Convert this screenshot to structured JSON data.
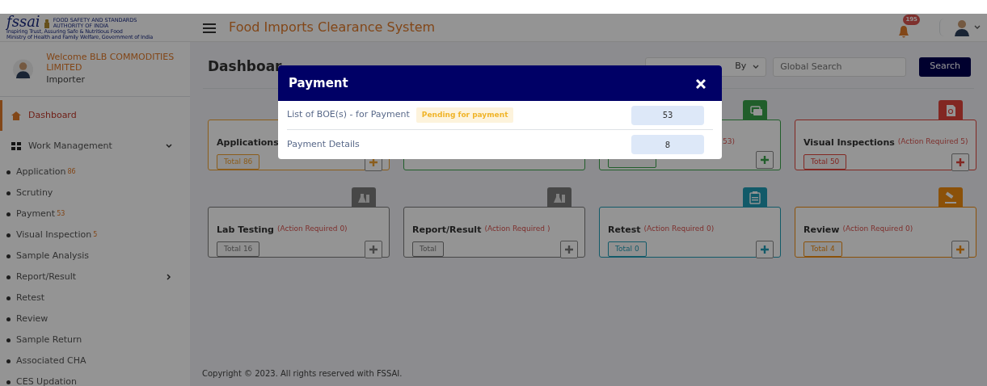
{
  "logo": {
    "wordmark": "fssai",
    "org": "FOOD SAFETY AND STANDARDS AUTHORITY OF INDIA",
    "tagline": "Inspiring Trust, Assuring Safe & Nutritious Food",
    "ministry": "Ministry of Health and Family Welfare, Government of India"
  },
  "header": {
    "title": "Food Imports Clearance System",
    "notifications": "195"
  },
  "user": {
    "welcome": "Welcome BLB COMMODITIES LIMITED",
    "role": "Importer"
  },
  "sidebar": {
    "items": [
      {
        "kind": "home",
        "label": "Dashboard",
        "selected": true
      },
      {
        "kind": "group",
        "label": "Work Management",
        "selected": false,
        "expanded": true
      },
      {
        "kind": "sub",
        "label": "Application",
        "count": "86",
        "selected": false
      },
      {
        "kind": "sub",
        "label": "Scrutiny",
        "selected": false
      },
      {
        "kind": "sub",
        "label": "Payment",
        "count": "53",
        "selected": false
      },
      {
        "kind": "sub",
        "label": "Visual Inspection",
        "count": "5",
        "selected": false
      },
      {
        "kind": "sub",
        "label": "Sample Analysis",
        "selected": false
      },
      {
        "kind": "sub",
        "label": "Report/Result",
        "selected": false,
        "expanded": false
      },
      {
        "kind": "sub",
        "label": "Retest",
        "selected": false
      },
      {
        "kind": "sub",
        "label": "Review",
        "selected": false
      },
      {
        "kind": "sub",
        "label": "Sample Return",
        "selected": false
      },
      {
        "kind": "sub",
        "label": "Associated CHA",
        "selected": false
      },
      {
        "kind": "sub",
        "label": "CES Updation",
        "selected": false
      }
    ]
  },
  "page": {
    "heading": "Dashboar",
    "search_by": "By",
    "search": {
      "placeholder": "Global Search"
    },
    "search_button": "Search"
  },
  "cards": [
    {
      "kind": "application",
      "title": "Applications",
      "total": "Total 86"
    },
    {
      "kind": "scrutiny"
    },
    {
      "kind": "payment",
      "action": "53)"
    },
    {
      "kind": "inspection",
      "title": "Visual Inspections",
      "action": "(Action Required 5)",
      "total": "Total 50"
    },
    {
      "kind": "lab",
      "title": "Lab Testing",
      "action": "(Action Required 0)",
      "total": "Total 16"
    },
    {
      "kind": "report",
      "title": "Report/Result",
      "action": "(Action Required )",
      "total": "Total"
    },
    {
      "kind": "retest",
      "title": "Retest",
      "action": "(Action Required 0)",
      "total": "Total 0"
    },
    {
      "kind": "review",
      "title": "Review",
      "action": "(Action Required 0)",
      "total": "Total 4"
    }
  ],
  "modal": {
    "title": "Payment",
    "rows": [
      {
        "label": "List of BOE(s) - for Payment",
        "tag": "Pending for payment",
        "count": "53"
      },
      {
        "label": "Payment Details",
        "count": "8"
      }
    ]
  },
  "footer": "Copyright © 2023. All rights reserved with FSSAI."
}
